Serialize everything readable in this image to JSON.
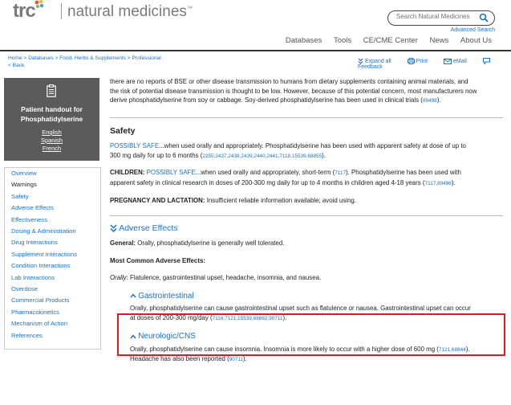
{
  "header": {
    "logo_mark": "trc",
    "logo_text": "natural medicines",
    "logo_tm": "™",
    "search_placeholder": "Search Natural Medicines",
    "advanced_search": "Advanced Search",
    "nav": [
      "Databases",
      "Tools",
      "CE/CME Center",
      "News",
      "About Us"
    ]
  },
  "breadcrumb": {
    "trail": "Home > Databases > Food, Herbs & Supplements > Professional",
    "back": "< Back"
  },
  "tools": {
    "expand_all": "Expand all",
    "print": "Print",
    "email": "eMail",
    "feedback": "Feedback"
  },
  "handout": {
    "title": "Patient handout for Phosphatidylserine",
    "languages": [
      "English",
      "Spanish",
      "French"
    ]
  },
  "sidenav": [
    "Overview",
    "Warnings",
    "Safety",
    "Adverse Effects",
    "Effectiveness",
    "Dosing & Administration",
    "Drug Interactions",
    "Supplement Interactions",
    "Condition Interactions",
    "Lab Interactions",
    "Overdose",
    "Commercial Products",
    "Pharmacokinetics",
    "Mechanism of Action",
    "References"
  ],
  "sidenav_active": "Warnings",
  "intro": {
    "line1": "there are no reports of BSE or other disease transmission to humans from dietary supplements containing animal materials, and",
    "line2": "the risk of potential disease transmission is thought to be low. However, because of this potential concern, most manufacturers now",
    "line3": "derive phosphatidylserine from soy or cabbage. Soy-derived phosphatidylserine has been used in clinical trials (",
    "cite": "89498",
    "line3_end": ")."
  },
  "safety": {
    "heading": "Safety",
    "possibly_safe_label": "POSSIBLY SAFE",
    "possibly_safe_text1": "...when used orally and appropriately. Phosphatidylserine has been used with apparent safety at dose of up to",
    "possibly_safe_text2": "300 mg daily for up to 6 months (",
    "possibly_safe_cites": "2255,2437,2438,2439,2440,2441,7118,15539,68855",
    "children_label": "CHILDREN:",
    "children_safe": "POSSIBLY SAFE",
    "children_text1": "...when used orally and appropriately, short-term (",
    "children_cite1": "7117",
    "children_text1b": "). Phosphatidylserine has been used with",
    "children_text2": "apparent safety in clinical research in doses of 200-300 mg daily for up to 4 months in children aged 4-18 years (",
    "children_cite2": "7117,89498",
    "pregnancy_label": "PREGNANCY AND LACTATION:",
    "pregnancy_text": "Insufficient reliable information available; avoid using."
  },
  "adverse": {
    "heading": "Adverse Effects",
    "general_label": "General:",
    "general_text": "Orally, phosphatidylserine is generally well tolerated.",
    "common_label": "Most Common Adverse Effects:",
    "orally_label": "Orally",
    "orally_text": ": Flatulence, gastrointestinal upset, headache, insomnia, and nausea.",
    "gi_heading": "Gastrointestinal",
    "gi_text1": "Orally, phosphatidylserine can cause gastrointestinal upset such as flatulence or nausea. Gastrointestinal upset can occur",
    "gi_text2": "at doses of 200-300 mg/day (",
    "gi_cites": "7116,7121,15539,68862,90711",
    "neuro_heading": "Neurologic/CNS",
    "neuro_text1": "Orally, phosphatidylserine can cause insomnia. Insomnia is more likely to occur with a higher dose of 600 mg (",
    "neuro_cite1": "7121,68844",
    "neuro_text2": "Headache has also been reported (",
    "neuro_cite2": "90711"
  },
  "colors": {
    "link": "#1a73c8",
    "highlight": "#e01b1b",
    "handout_bg": "#5b5b5b"
  }
}
